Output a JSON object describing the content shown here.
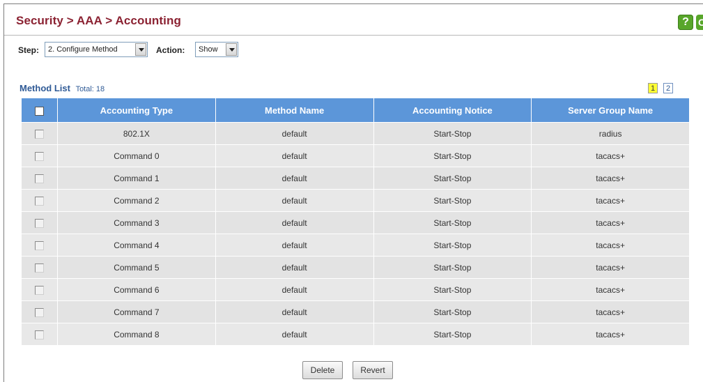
{
  "header": {
    "title": "Security > AAA > Accounting",
    "help_label": "?",
    "help2_label": "C"
  },
  "controls": {
    "step_label": "Step:",
    "step_value": "2. Configure Method",
    "action_label": "Action:",
    "action_value": "Show"
  },
  "list": {
    "caption": "Method List",
    "total": "Total: 18",
    "pages": [
      "1",
      "2"
    ],
    "active_page": "1"
  },
  "table": {
    "columns": [
      "Accounting Type",
      "Method Name",
      "Accounting Notice",
      "Server Group Name"
    ],
    "rows": [
      [
        "802.1X",
        "default",
        "Start-Stop",
        "radius"
      ],
      [
        "Command 0",
        "default",
        "Start-Stop",
        "tacacs+"
      ],
      [
        "Command 1",
        "default",
        "Start-Stop",
        "tacacs+"
      ],
      [
        "Command 2",
        "default",
        "Start-Stop",
        "tacacs+"
      ],
      [
        "Command 3",
        "default",
        "Start-Stop",
        "tacacs+"
      ],
      [
        "Command 4",
        "default",
        "Start-Stop",
        "tacacs+"
      ],
      [
        "Command 5",
        "default",
        "Start-Stop",
        "tacacs+"
      ],
      [
        "Command 6",
        "default",
        "Start-Stop",
        "tacacs+"
      ],
      [
        "Command 7",
        "default",
        "Start-Stop",
        "tacacs+"
      ],
      [
        "Command 8",
        "default",
        "Start-Stop",
        "tacacs+"
      ]
    ]
  },
  "buttons": {
    "delete": "Delete",
    "revert": "Revert"
  },
  "colors": {
    "title": "#8b2232",
    "header_bg": "#5c96d9",
    "help_green": "#58a62a"
  }
}
